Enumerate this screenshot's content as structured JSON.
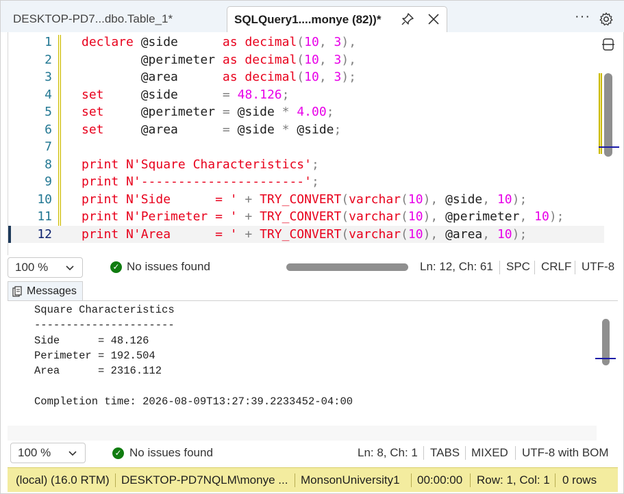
{
  "tabs": [
    {
      "label": "DESKTOP-PD7...dbo.Table_1*",
      "active": false
    },
    {
      "label": "SQLQuery1....monye (82))*",
      "active": true
    }
  ],
  "icons": {
    "pin": "pin-icon",
    "close": "close-icon",
    "more": "more-icon",
    "gear": "gear-icon",
    "split": "split-editor-icon",
    "check": "check-circle-icon",
    "chevron": "chevron-down-icon",
    "messages": "messages-icon"
  },
  "editor": {
    "lines": [
      {
        "n": "1",
        "tokens": [
          [
            "kw",
            "declare "
          ],
          [
            "var",
            "@side      "
          ],
          [
            "kw",
            "as "
          ],
          [
            "fn",
            "decimal"
          ],
          [
            "op",
            "("
          ],
          [
            "num",
            "10"
          ],
          [
            "op",
            ", "
          ],
          [
            "num",
            "3"
          ],
          [
            "op",
            "),"
          ]
        ]
      },
      {
        "n": "2",
        "tokens": [
          [
            "var",
            "        @perimeter "
          ],
          [
            "kw",
            "as "
          ],
          [
            "fn",
            "decimal"
          ],
          [
            "op",
            "("
          ],
          [
            "num",
            "10"
          ],
          [
            "op",
            ", "
          ],
          [
            "num",
            "3"
          ],
          [
            "op",
            "),"
          ]
        ]
      },
      {
        "n": "3",
        "tokens": [
          [
            "var",
            "        @area      "
          ],
          [
            "kw",
            "as "
          ],
          [
            "fn",
            "decimal"
          ],
          [
            "op",
            "("
          ],
          [
            "num",
            "10"
          ],
          [
            "op",
            ", "
          ],
          [
            "num",
            "3"
          ],
          [
            "op",
            ");"
          ]
        ]
      },
      {
        "n": "4",
        "tokens": [
          [
            "kw",
            "set     "
          ],
          [
            "var",
            "@side      "
          ],
          [
            "op",
            "= "
          ],
          [
            "num",
            "48.126"
          ],
          [
            "op",
            ";"
          ]
        ]
      },
      {
        "n": "5",
        "tokens": [
          [
            "kw",
            "set     "
          ],
          [
            "var",
            "@perimeter "
          ],
          [
            "op",
            "= "
          ],
          [
            "var",
            "@side "
          ],
          [
            "op",
            "* "
          ],
          [
            "num",
            "4.00"
          ],
          [
            "op",
            ";"
          ]
        ]
      },
      {
        "n": "6",
        "tokens": [
          [
            "kw",
            "set     "
          ],
          [
            "var",
            "@area      "
          ],
          [
            "op",
            "= "
          ],
          [
            "var",
            "@side "
          ],
          [
            "op",
            "* "
          ],
          [
            "var",
            "@side"
          ],
          [
            "op",
            ";"
          ]
        ]
      },
      {
        "n": "7",
        "tokens": []
      },
      {
        "n": "8",
        "tokens": [
          [
            "kw",
            "print "
          ],
          [
            "str",
            "N'Square Characteristics'"
          ],
          [
            "op",
            ";"
          ]
        ]
      },
      {
        "n": "9",
        "tokens": [
          [
            "kw",
            "print "
          ],
          [
            "str",
            "N'----------------------'"
          ],
          [
            "op",
            ";"
          ]
        ]
      },
      {
        "n": "10",
        "tokens": [
          [
            "kw",
            "print "
          ],
          [
            "str",
            "N'Side      = ' "
          ],
          [
            "op",
            "+ "
          ],
          [
            "fn",
            "TRY_CONVERT"
          ],
          [
            "op",
            "("
          ],
          [
            "fn",
            "varchar"
          ],
          [
            "op",
            "("
          ],
          [
            "num",
            "10"
          ],
          [
            "op",
            "), "
          ],
          [
            "var",
            "@side"
          ],
          [
            "op",
            ", "
          ],
          [
            "num",
            "10"
          ],
          [
            "op",
            ");"
          ]
        ]
      },
      {
        "n": "11",
        "tokens": [
          [
            "kw",
            "print "
          ],
          [
            "str",
            "N'Perimeter = ' "
          ],
          [
            "op",
            "+ "
          ],
          [
            "fn",
            "TRY_CONVERT"
          ],
          [
            "op",
            "("
          ],
          [
            "fn",
            "varchar"
          ],
          [
            "op",
            "("
          ],
          [
            "num",
            "10"
          ],
          [
            "op",
            "), "
          ],
          [
            "var",
            "@perimeter"
          ],
          [
            "op",
            ", "
          ],
          [
            "num",
            "10"
          ],
          [
            "op",
            ");"
          ]
        ]
      },
      {
        "n": "12",
        "tokens": [
          [
            "kw",
            "print "
          ],
          [
            "str",
            "N'Area      = ' "
          ],
          [
            "op",
            "+ "
          ],
          [
            "fn",
            "TRY_CONVERT"
          ],
          [
            "op",
            "("
          ],
          [
            "fn",
            "varchar"
          ],
          [
            "op",
            "("
          ],
          [
            "num",
            "10"
          ],
          [
            "op",
            "), "
          ],
          [
            "var",
            "@area"
          ],
          [
            "op",
            ", "
          ],
          [
            "num",
            "10"
          ],
          [
            "op",
            ");"
          ]
        ]
      }
    ],
    "current_line": "12",
    "colors": {
      "keyword": "#e8001c",
      "number": "#e800e8",
      "operator": "#808080",
      "line_number": "#237893"
    }
  },
  "editor_status": {
    "zoom": "100 %",
    "issues": "No issues found",
    "position": "Ln: 12, Ch: 61",
    "whitespace": "SPC",
    "line_ending": "CRLF",
    "encoding": "UTF-8"
  },
  "messages": {
    "tab_label": "Messages",
    "lines": [
      "Square Characteristics",
      "----------------------",
      "Side      = 48.126",
      "Perimeter = 192.504",
      "Area      = 2316.112",
      "",
      "Completion time: 2026-08-09T13:27:39.2233452-04:00"
    ]
  },
  "messages_status": {
    "zoom": "100 %",
    "issues": "No issues found",
    "position": "Ln: 8, Ch: 1",
    "whitespace": "TABS",
    "line_ending": "MIXED",
    "encoding": "UTF-8 with BOM"
  },
  "connection": {
    "server": "(local) (16.0 RTM)",
    "user": "DESKTOP-PD7NQLM\\monye ...",
    "database": "MonsonUniversity1",
    "elapsed": "00:00:00",
    "cursor": "Row: 1, Col: 1",
    "rows": "0 rows",
    "bar_color": "#f3ec9f"
  }
}
